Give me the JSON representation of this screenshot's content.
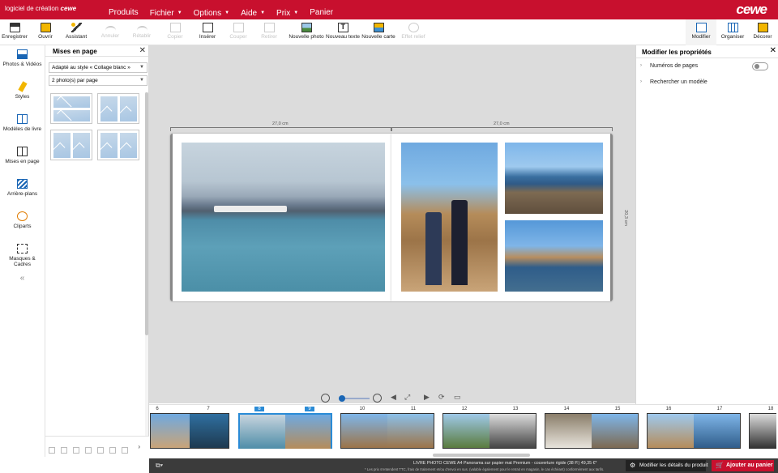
{
  "app": {
    "title": "logiciel de création",
    "brand_small": "cewe",
    "brand": "cewe"
  },
  "menu": [
    {
      "label": "Produits",
      "has_dropdown": false
    },
    {
      "label": "Fichier",
      "has_dropdown": true
    },
    {
      "label": "Options",
      "has_dropdown": true
    },
    {
      "label": "Aide",
      "has_dropdown": true
    },
    {
      "label": "Prix",
      "has_dropdown": true
    },
    {
      "label": "Panier",
      "has_dropdown": false
    }
  ],
  "toolbar": {
    "save": "Enregistrer",
    "open": "Ouvrir",
    "assistant": "Assistant",
    "undo": "Annuler",
    "redo": "Rétablir",
    "copy": "Copier",
    "paste": "Insérer",
    "cut": "Couper",
    "remove": "Retirer",
    "new_photo": "Nouvelle photo",
    "new_text": "Nouveau texte",
    "new_card": "Nouvelle carte",
    "effect": "Effet relief",
    "modify": "Modifier",
    "organize": "Organiser",
    "decorate": "Décorer"
  },
  "sidebar": {
    "items": [
      {
        "label": "Photos & Vidéos",
        "icon": "photos-videos-icon"
      },
      {
        "label": "Styles",
        "icon": "styles-icon"
      },
      {
        "label": "Modèles de livre",
        "icon": "book-templates-icon"
      },
      {
        "label": "Mises en page",
        "icon": "layouts-icon"
      },
      {
        "label": "Arrière-plans",
        "icon": "backgrounds-icon"
      },
      {
        "label": "Cliparts",
        "icon": "cliparts-icon"
      },
      {
        "label": "Masques & Cadres",
        "icon": "masks-frames-icon"
      }
    ],
    "collapse": "«"
  },
  "layout_panel": {
    "title": "Mises en page",
    "style_select": "Adapté au style « Collage blanc »",
    "count_select": "2 photo(s) par page"
  },
  "canvas": {
    "width_label_left": "27,0 cm",
    "width_label_right": "27,0 cm",
    "height_label": "20,3 cm"
  },
  "properties": {
    "title": "Modifier les propriétés",
    "rows": [
      {
        "label": "Numéros de pages",
        "toggle": false
      },
      {
        "label": "Rechercher un modèle"
      }
    ]
  },
  "filmstrip": {
    "pages": [
      "6",
      "7",
      "8",
      "9",
      "10",
      "11",
      "12",
      "13",
      "14",
      "15",
      "16",
      "17",
      "18"
    ],
    "active_pages": [
      "8",
      "9"
    ]
  },
  "status": {
    "info": "LIVRE PHOTO CEWE A4 Panorama sur papier mat Premium - couverture rigide (38 P.) 49,35 €*",
    "note": "* Les prix s'entendent TTC, frais de traitement et/ou d'envoi en sus. (valable également pour le retrait en magasin, le cas échéant) conformément aux tarifs.",
    "details_button": "Modifier les détails du produit",
    "cart_button": "Ajouter au panier"
  },
  "colors": {
    "brand_red": "#c8102e",
    "accent_blue": "#1a66b5",
    "active_page": "#2a8bd6"
  }
}
